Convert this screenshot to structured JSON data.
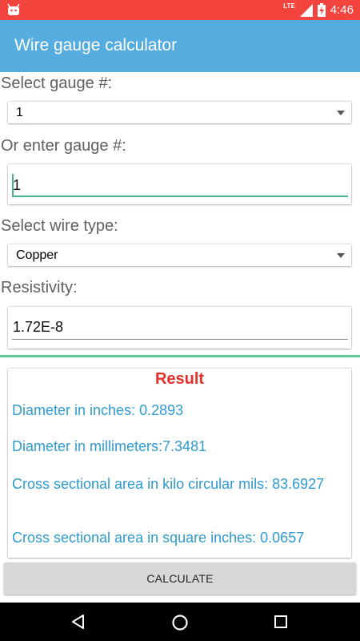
{
  "status_bar": {
    "time": "4:46",
    "network": "LTE",
    "icons": [
      "android-notification-icon",
      "signal-icon",
      "battery-charging-icon"
    ]
  },
  "app_bar": {
    "title": "Wire gauge calculator"
  },
  "form": {
    "select_gauge_label": "Select gauge #:",
    "gauge_selected": "1",
    "enter_gauge_label": "Or enter gauge #:",
    "gauge_input_value": "1",
    "wire_type_label": "Select wire type:",
    "wire_type_selected": "Copper",
    "resistivity_label": "Resistivity:",
    "resistivity_value": "1.72E-8"
  },
  "result": {
    "title": "Result",
    "diameter_inches": "Diameter in inches: 0.2893",
    "diameter_mm": "Diameter in millimeters:7.3481",
    "area_kcmil": "Cross sectional area in kilo circular mils: 83.6927",
    "area_sq_in": "Cross sectional area in square inches: 0.0657"
  },
  "calculate_button": {
    "label": "CALCULATE"
  },
  "nav_bar": {
    "icons": [
      "back-icon",
      "home-icon",
      "recents-icon"
    ]
  },
  "colors": {
    "status_bar": "#f2443c",
    "app_bar": "#55acde",
    "accent": "#49b395",
    "result_title": "#e5302a",
    "result_text": "#2e9ad0"
  }
}
